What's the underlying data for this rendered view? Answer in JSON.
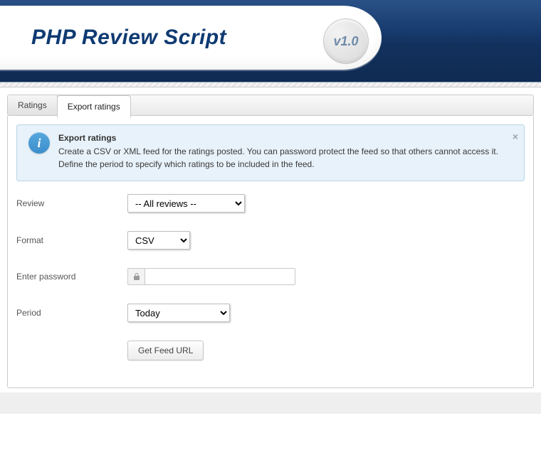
{
  "header": {
    "title": "PHP Review Script",
    "version": "v1.0"
  },
  "tabs": {
    "ratings": "Ratings",
    "export": "Export ratings",
    "active": "export"
  },
  "info": {
    "title": "Export ratings",
    "body": "Create a CSV or XML feed for the ratings posted. You can password protect the feed so that others cannot access it. Define the period to specify which ratings to be included in the feed."
  },
  "form": {
    "review": {
      "label": "Review",
      "value": "-- All reviews --"
    },
    "format": {
      "label": "Format",
      "value": "CSV"
    },
    "password": {
      "label": "Enter password",
      "value": ""
    },
    "period": {
      "label": "Period",
      "value": "Today"
    },
    "submit": "Get Feed URL"
  },
  "icons": {
    "info": "i",
    "close": "×"
  }
}
